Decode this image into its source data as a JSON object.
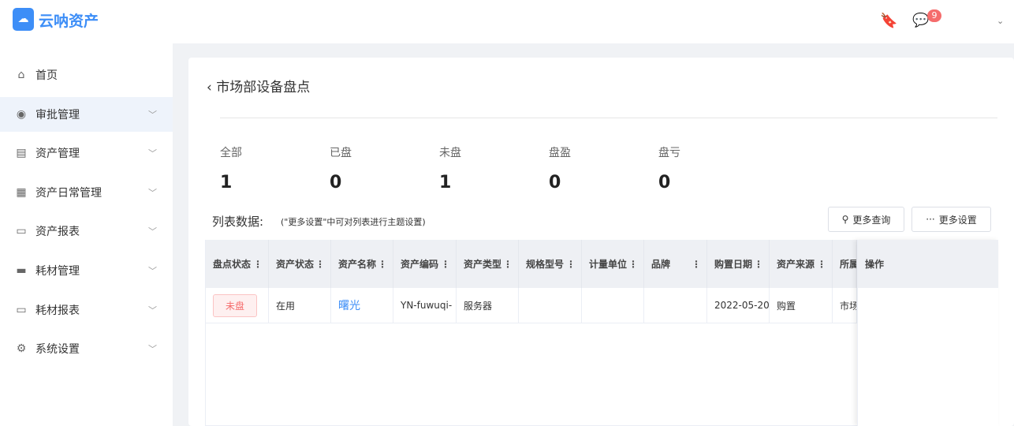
{
  "app": {
    "name": "云呐资产",
    "notification_count": "9"
  },
  "sidebar": {
    "items": [
      {
        "label": "首页",
        "icon": "home-icon"
      },
      {
        "label": "审批管理",
        "icon": "eye-icon",
        "active": true
      },
      {
        "label": "资产管理",
        "icon": "asset-icon"
      },
      {
        "label": "资产日常管理",
        "icon": "calendar-icon"
      },
      {
        "label": "资产报表",
        "icon": "report-icon"
      },
      {
        "label": "耗材管理",
        "icon": "box-icon"
      },
      {
        "label": "耗材报表",
        "icon": "report-icon"
      },
      {
        "label": "系统设置",
        "icon": "gear-icon"
      }
    ]
  },
  "page": {
    "title": "市场部设备盘点"
  },
  "stats": [
    {
      "label": "全部",
      "value": "1"
    },
    {
      "label": "已盘",
      "value": "0"
    },
    {
      "label": "未盘",
      "value": "1"
    },
    {
      "label": "盘盈",
      "value": "0"
    },
    {
      "label": "盘亏",
      "value": "0"
    }
  ],
  "list": {
    "label": "列表数据:",
    "hint": "(\"更多设置\"中可对列表进行主题设置)",
    "search_button": "更多查询",
    "settings_button": "更多设置"
  },
  "table": {
    "columns": [
      "盘点状态",
      "资产状态",
      "资产名称",
      "资产编码",
      "资产类型",
      "规格型号",
      "计量单位",
      "品牌",
      "购置日期",
      "资产来源",
      "所属"
    ],
    "action_column": "操作",
    "rows": [
      [
        "未盘",
        "在用",
        "曙光",
        "YN-fuwuqi-",
        "服务器",
        "",
        "",
        "",
        "2022-05-20",
        "购置",
        "市场"
      ]
    ]
  },
  "colors": {
    "accent": "#3d8ef7",
    "danger": "#f56c6c"
  }
}
